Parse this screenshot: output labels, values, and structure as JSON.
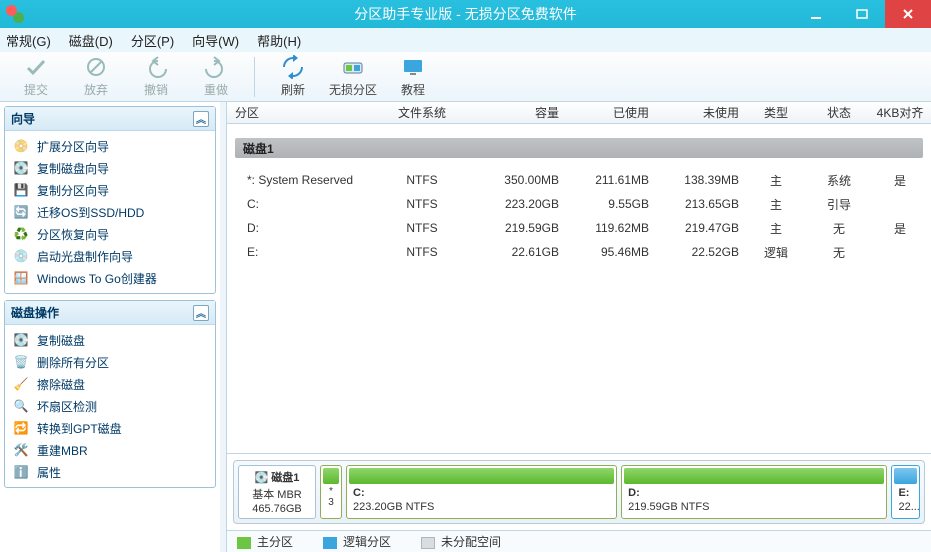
{
  "title": "分区助手专业版 - 无损分区免费软件",
  "menu": {
    "m0": "常规(G)",
    "m1": "磁盘(D)",
    "m2": "分区(P)",
    "m3": "向导(W)",
    "m4": "帮助(H)"
  },
  "toolbar": {
    "t0": "提交",
    "t1": "放弃",
    "t2": "撤销",
    "t3": "重做",
    "t4": "刷新",
    "t5": "无损分区",
    "t6": "教程"
  },
  "panels": {
    "wizard_title": "向导",
    "ops_title": "磁盘操作",
    "wiz": [
      "扩展分区向导",
      "复制磁盘向导",
      "复制分区向导",
      "迁移OS到SSD/HDD",
      "分区恢复向导",
      "启动光盘制作向导",
      "Windows To Go创建器"
    ],
    "ops": [
      "复制磁盘",
      "删除所有分区",
      "擦除磁盘",
      "坏扇区检测",
      "转换到GPT磁盘",
      "重建MBR",
      "属性"
    ]
  },
  "columns": {
    "part": "分区",
    "fs": "文件系统",
    "cap": "容量",
    "used": "已使用",
    "free": "未使用",
    "type": "类型",
    "status": "状态",
    "align": "4KB对齐"
  },
  "disk_header": "磁盘1",
  "rows": [
    {
      "part": "*: System Reserved",
      "fs": "NTFS",
      "cap": "350.00MB",
      "used": "211.61MB",
      "free": "138.39MB",
      "type": "主",
      "status": "系统",
      "align": "是"
    },
    {
      "part": "C:",
      "fs": "NTFS",
      "cap": "223.20GB",
      "used": "9.55GB",
      "free": "213.65GB",
      "type": "主",
      "status": "引导",
      "align": ""
    },
    {
      "part": "D:",
      "fs": "NTFS",
      "cap": "219.59GB",
      "used": "119.62MB",
      "free": "219.47GB",
      "type": "主",
      "status": "无",
      "align": "是"
    },
    {
      "part": "E:",
      "fs": "NTFS",
      "cap": "22.61GB",
      "used": "95.46MB",
      "free": "22.52GB",
      "type": "逻辑",
      "status": "无",
      "align": ""
    }
  ],
  "diskmap": {
    "disk_name": "磁盘1",
    "disk_sub1": "基本 MBR",
    "disk_sub2": "465.76GB",
    "p0_label": "*",
    "p0_sub": "3",
    "p1_label": "C:",
    "p1_sub": "223.20GB NTFS",
    "p2_label": "D:",
    "p2_sub": "219.59GB NTFS",
    "p3_label": "E:",
    "p3_sub": "22...."
  },
  "legend": {
    "l0": "主分区",
    "l1": "逻辑分区",
    "l2": "未分配空间"
  }
}
